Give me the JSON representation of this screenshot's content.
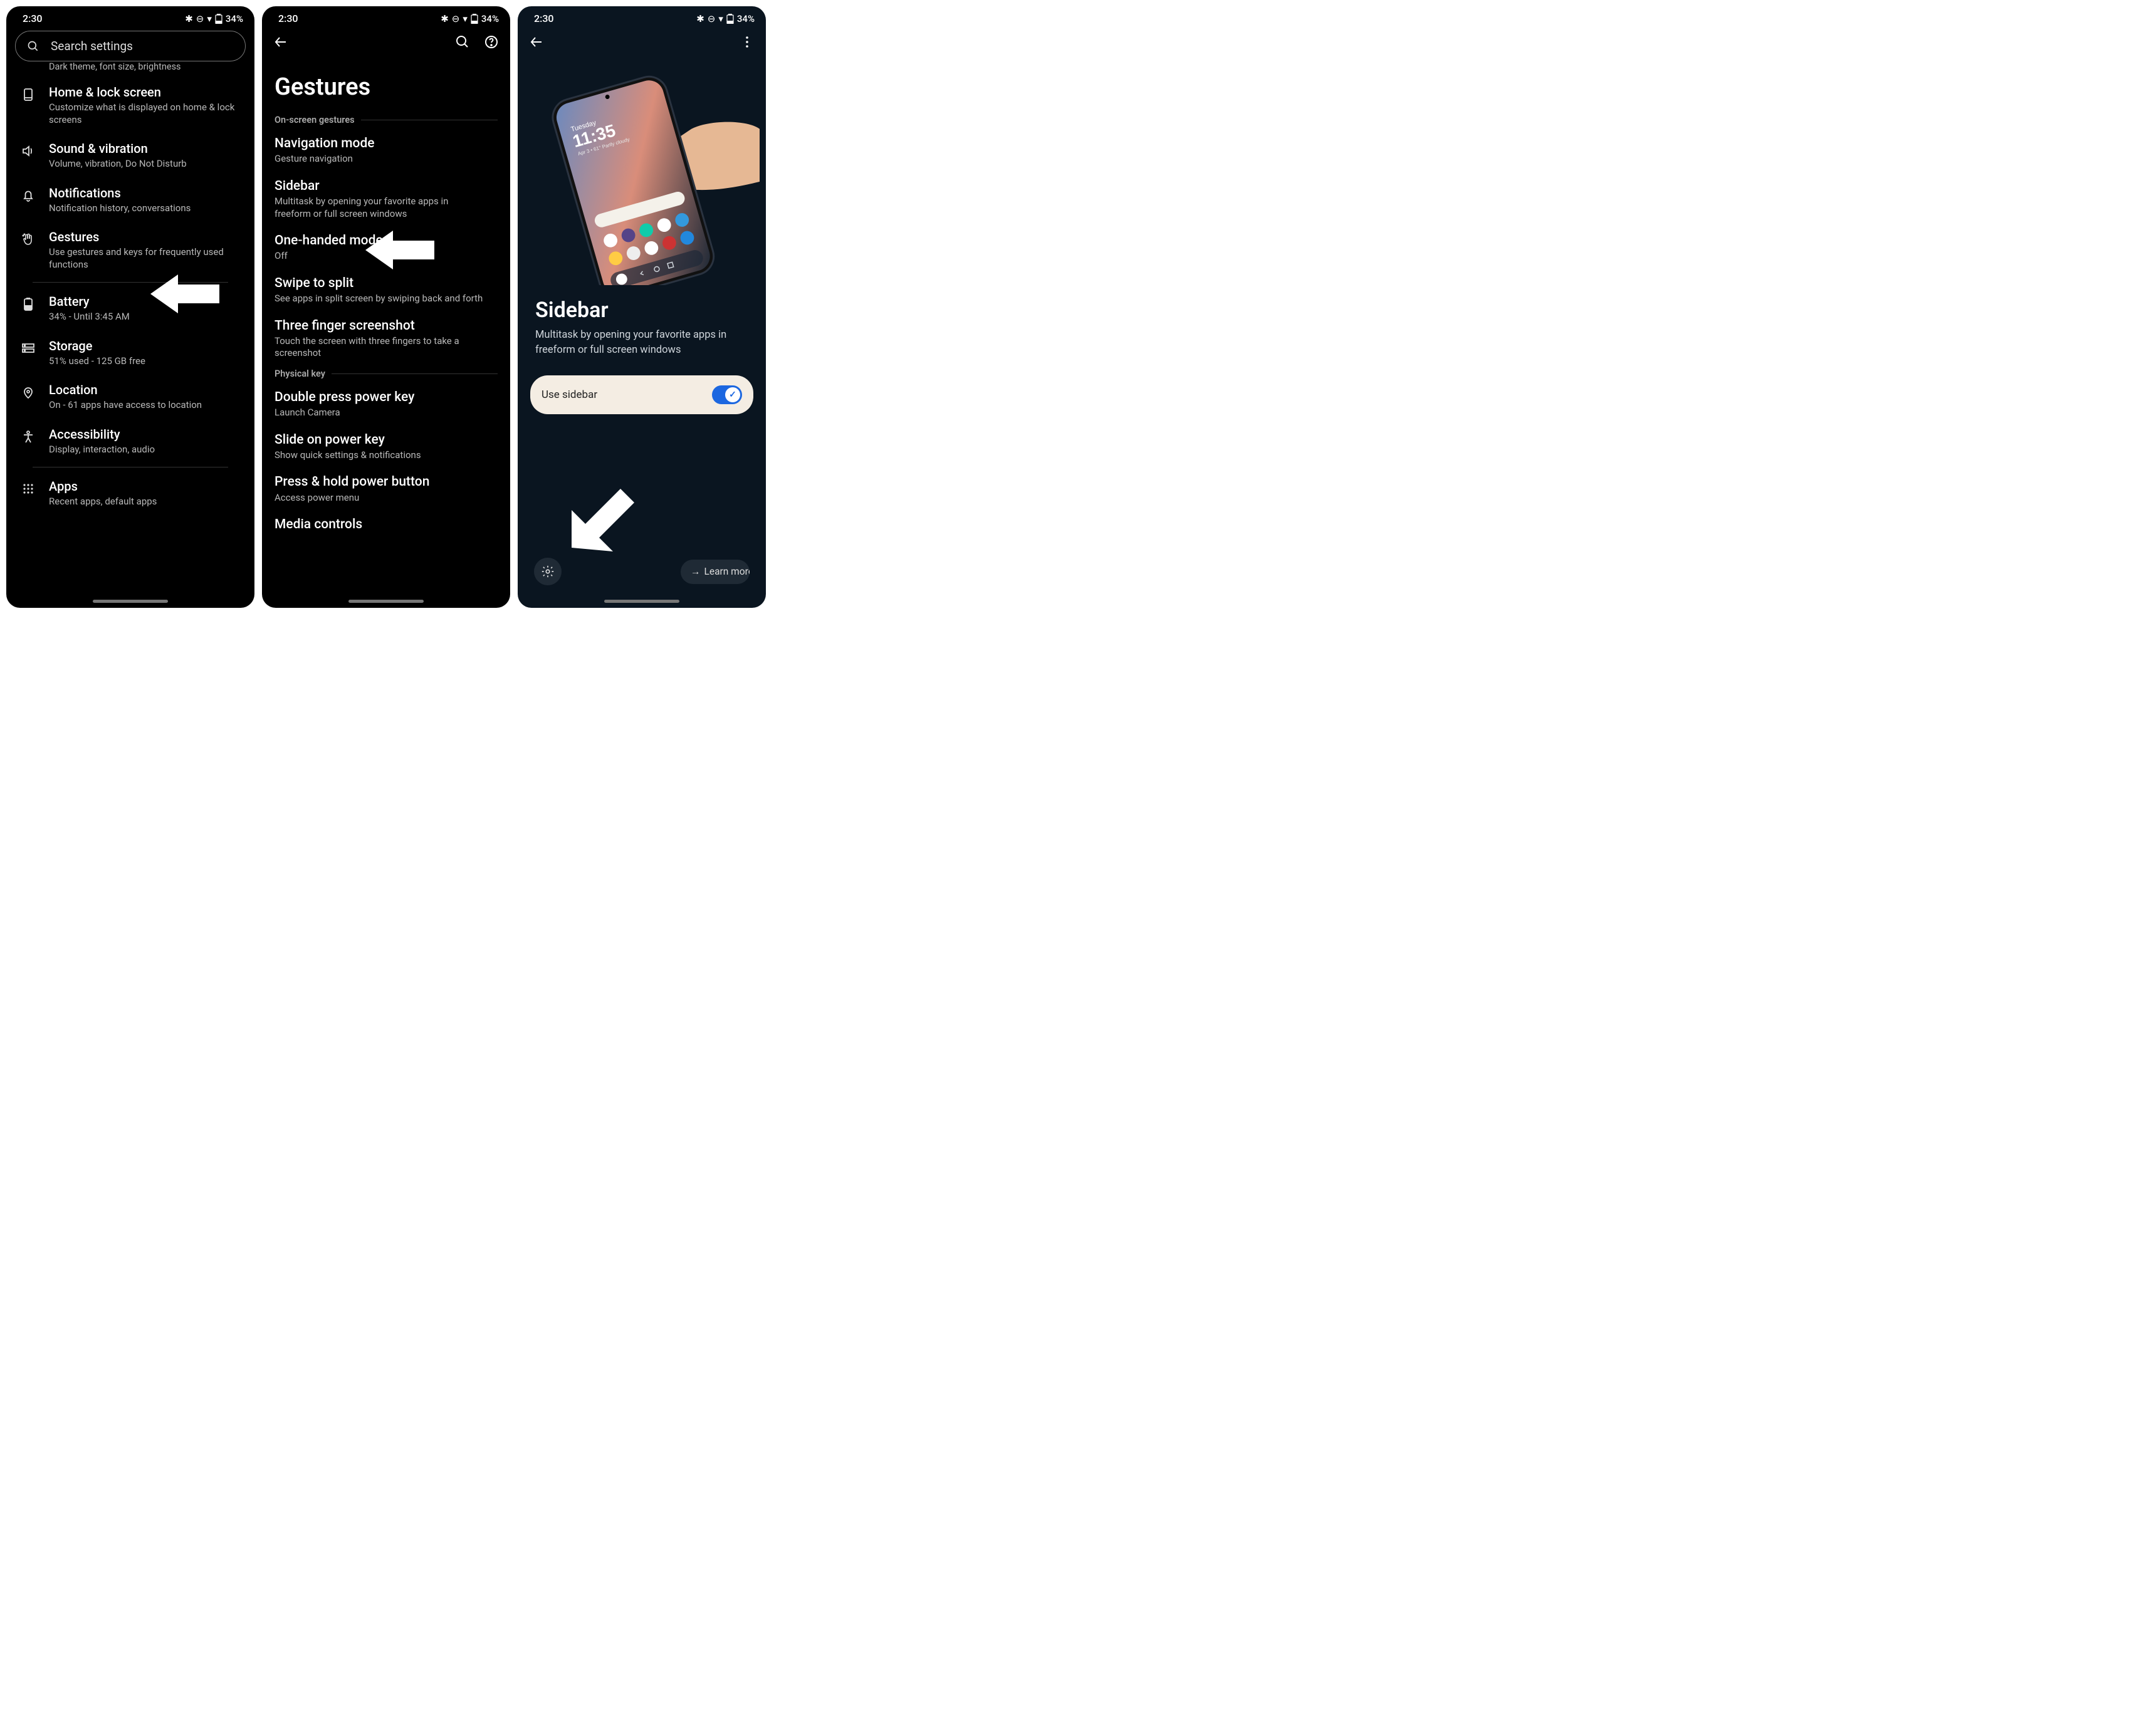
{
  "status": {
    "time": "2:30",
    "battery": "34%"
  },
  "panel1": {
    "search_placeholder": "Search settings",
    "display_sub_cut": "Dark theme, font size, brightness",
    "items": [
      {
        "title": "Home & lock screen",
        "sub": "Customize what is displayed on home & lock screens",
        "icon": "home-lock"
      },
      {
        "title": "Sound & vibration",
        "sub": "Volume, vibration, Do Not Disturb",
        "icon": "volume"
      },
      {
        "title": "Notifications",
        "sub": "Notification history, conversations",
        "icon": "bell"
      },
      {
        "title": "Gestures",
        "sub": "Use gestures and keys for frequently used functions",
        "icon": "hand"
      },
      {
        "title": "Battery",
        "sub": "34% - Until 3:45 AM",
        "icon": "battery"
      },
      {
        "title": "Storage",
        "sub": "51% used - 125 GB free",
        "icon": "storage"
      },
      {
        "title": "Location",
        "sub": "On - 61 apps have access to location",
        "icon": "pin"
      },
      {
        "title": "Accessibility",
        "sub": "Display, interaction, audio",
        "icon": "person"
      },
      {
        "title": "Apps",
        "sub": "Recent apps, default apps",
        "icon": "grid"
      }
    ]
  },
  "panel2": {
    "title": "Gestures",
    "section1": "On-screen gestures",
    "section2": "Physical key",
    "items1": [
      {
        "title": "Navigation mode",
        "sub": "Gesture navigation"
      },
      {
        "title": "Sidebar",
        "sub": "Multitask by opening your favorite apps in freeform or full screen windows"
      },
      {
        "title": "One-handed mode",
        "sub": "Off"
      },
      {
        "title": "Swipe to split",
        "sub": "See apps in split screen by swiping back and forth"
      },
      {
        "title": "Three finger screenshot",
        "sub": "Touch the screen with three fingers to take a screenshot"
      }
    ],
    "items2": [
      {
        "title": "Double press power key",
        "sub": "Launch Camera"
      },
      {
        "title": "Slide on power key",
        "sub": "Show quick settings & notifications"
      },
      {
        "title": "Press & hold power button",
        "sub": "Access power menu"
      },
      {
        "title": "Media controls",
        "sub": ""
      }
    ]
  },
  "panel3": {
    "title": "Sidebar",
    "desc": "Multitask by opening your favorite apps in freeform or full screen windows",
    "toggle_label": "Use sidebar",
    "toggle_on": true,
    "learn_more": "Learn more",
    "preview": {
      "day": "Tuesday",
      "time": "11:35",
      "date_line": "Apr 3  61°  Partly cloudy"
    }
  }
}
